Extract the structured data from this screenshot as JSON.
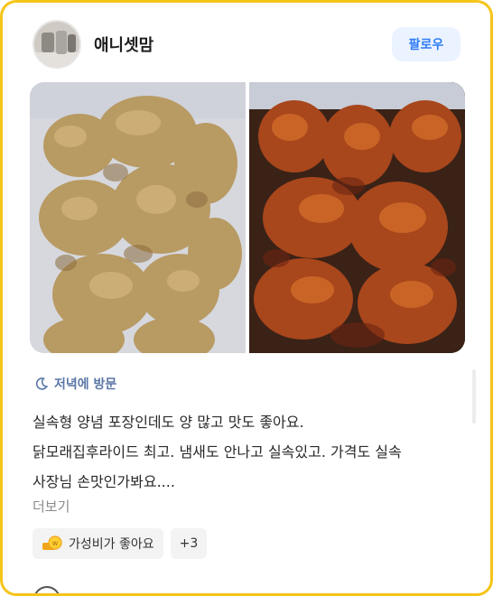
{
  "header": {
    "username": "애니셋맘",
    "follow_label": "팔로우"
  },
  "photos": [
    {
      "description_icon": "fried-chicken-photo"
    },
    {
      "description_icon": "seasoned-chicken-photo"
    }
  ],
  "visit": {
    "icon": "moon-icon",
    "label": "저녁에 방문"
  },
  "review": {
    "line1": "실속형 양념 포장인데도 양 많고 맛도 좋아요.",
    "line2": "닭모래집후라이드 최고. 냄새도 안나고 실속있고. 가격도 실속",
    "line3": "사장님 손맛인가봐요....",
    "more_label": "더보기"
  },
  "chips": [
    {
      "icon": "coin-icon",
      "label": "가성비가 좋아요"
    },
    {
      "label": "+3"
    }
  ],
  "colors": {
    "frame_border": "#f5c518",
    "follow_bg": "#eaf3ff",
    "follow_text": "#2f7cf6",
    "visit_text": "#5a76a6"
  }
}
